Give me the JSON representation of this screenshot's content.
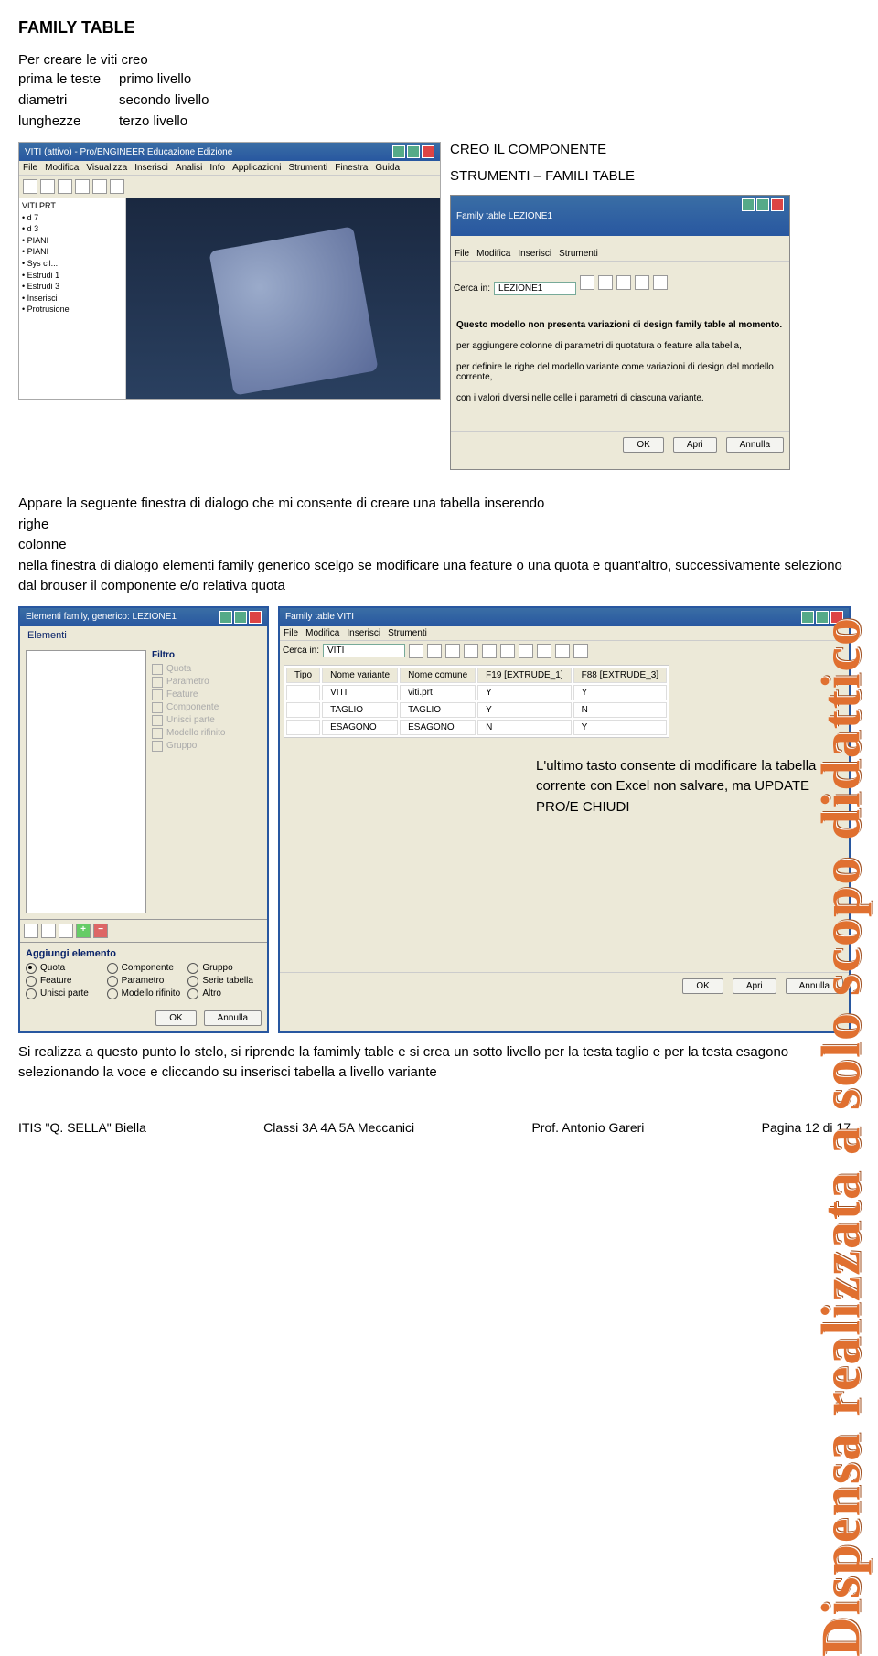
{
  "title": "FAMILY TABLE",
  "intro": {
    "line1": "Per creare le viti creo",
    "grid": [
      [
        "prima le teste",
        "primo livello"
      ],
      [
        "diametri",
        "secondo livello"
      ],
      [
        "lunghezze",
        "terzo livello"
      ]
    ]
  },
  "annotate1": {
    "line1": "CREO IL COMPONENTE",
    "line2": "STRUMENTI – FAMILI TABLE"
  },
  "mainWindow": {
    "title": "VITI (attivo) - Pro/ENGINEER Educazione Edizione",
    "menus": [
      "File",
      "Modifica",
      "Visualizza",
      "Inserisci",
      "Analisi",
      "Info",
      "Applicazioni",
      "Strumenti",
      "Finestra",
      "Guida"
    ],
    "tree": [
      "VITI.PRT",
      "• d 7",
      "• d 3",
      "• PIANI",
      "• PIANI",
      "• Sys cil...",
      "• Estrudi 1",
      "• Estrudi 3",
      "• Inserisci",
      "• Protrusione"
    ]
  },
  "ftDialog": {
    "title": "Family table LEZIONE1",
    "menus": [
      "File",
      "Modifica",
      "Inserisci",
      "Strumenti"
    ],
    "searchLabel": "Cerca in:",
    "searchValue": "LEZIONE1",
    "helpLines": [
      "Questo modello non presenta variazioni di design family table al momento.",
      "per aggiungere colonne di parametri di quotatura o feature alla tabella,",
      "per definire le righe del modello variante come variazioni di design del modello corrente,",
      "con i valori diversi nelle celle i parametri di ciascuna variante."
    ],
    "buttons": {
      "ok": "OK",
      "open": "Apri",
      "cancel": "Annulla"
    }
  },
  "para1": "Appare la seguente finestra di dialogo che mi consente di creare una tabella inserendo",
  "para1b": "righe",
  "para1c": "colonne",
  "para1d": "nella finestra di dialogo elementi family generico scelgo se modificare una feature o una quota e quant'altro, successivamente seleziono dal brouser il componente e/o relativa quota",
  "elemDialog": {
    "title": "Elementi family, generico: LEZIONE1",
    "leftLabel": "Elementi",
    "filterLabel": "Filtro",
    "filters": [
      "Quota",
      "Parametro",
      "Feature",
      "Componente",
      "Unisci parte",
      "Modello rifinito",
      "Gruppo"
    ],
    "addLabel": "Aggiungi elemento",
    "radios": [
      {
        "label": "Quota",
        "sel": true
      },
      {
        "label": "Componente",
        "sel": false
      },
      {
        "label": "Gruppo",
        "sel": false
      },
      {
        "label": "Feature",
        "sel": false
      },
      {
        "label": "Parametro",
        "sel": false
      },
      {
        "label": "Serie tabella",
        "sel": false
      },
      {
        "label": "Unisci parte",
        "sel": false
      },
      {
        "label": "Modello rifinito",
        "sel": false
      },
      {
        "label": "Altro",
        "sel": false
      }
    ],
    "ok": "OK",
    "cancel": "Annulla"
  },
  "vitiDialog": {
    "title": "Family table VITI",
    "menus": [
      "File",
      "Modifica",
      "Inserisci",
      "Strumenti"
    ],
    "searchLabel": "Cerca in:",
    "searchValue": "VITI",
    "headers": [
      "Tipo",
      "Nome variante",
      "Nome comune",
      "F19 [EXTRUDE_1]",
      "F88 [EXTRUDE_3]"
    ],
    "rows": [
      [
        "",
        "VITI",
        "viti.prt",
        "Y",
        "Y"
      ],
      [
        "",
        "TAGLIO",
        "TAGLIO",
        "Y",
        "N"
      ],
      [
        "",
        "ESAGONO",
        "ESAGONO",
        "N",
        "Y"
      ]
    ],
    "ok": "OK",
    "open": "Apri",
    "cancel": "Annulla"
  },
  "annotate2": "L'ultimo tasto consente di modificare la tabella corrente con Excel non salvare, ma UPDATE PRO/E CHIUDI",
  "para2": "Si realizza a questo punto lo stelo, si riprende la famimly table e si crea un sotto livello per la testa taglio e per la testa esagono selezionando la voce e cliccando su inserisci tabella a livello variante",
  "footer": {
    "left": "ITIS \"Q. SELLA\" Biella",
    "mid": "Classi 3A 4A 5A Meccanici",
    "right1": "Prof. Antonio Gareri",
    "right2": "Pagina 12 di 17"
  },
  "watermark": "Dispensa realizzata a solo scopo didattico"
}
